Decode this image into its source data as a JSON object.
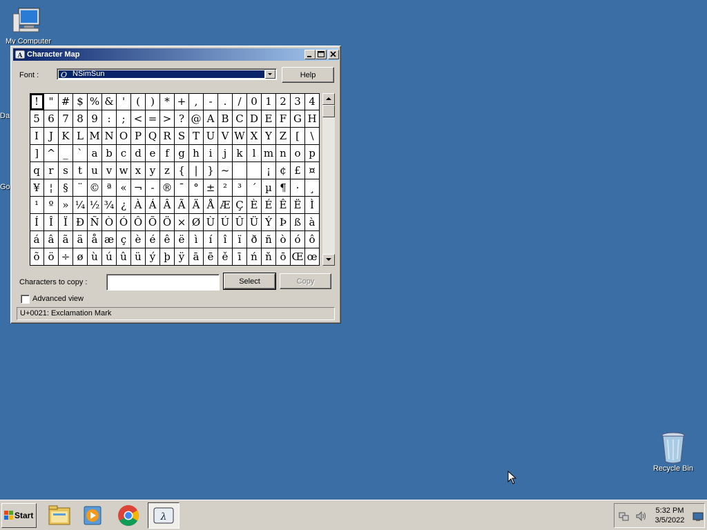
{
  "desktop": {
    "my_computer": "My Computer",
    "recycle_bin": "Recycle Bin",
    "partial_labels": [
      "Da",
      "Go"
    ],
    "background": "#3a6ea5"
  },
  "window": {
    "title": "Character Map",
    "font_label": "Font :",
    "font_value": "NSimSun",
    "help_label": "Help",
    "chars_to_copy_label": "Characters to copy :",
    "chars_to_copy_value": "",
    "select_label": "Select",
    "copy_label": "Copy",
    "advanced_label": "Advanced view",
    "advanced_checked": false,
    "status": "U+0021: Exclamation Mark",
    "characters": [
      [
        "!",
        "\"",
        "#",
        "$",
        "%",
        "&",
        "'",
        "(",
        ")",
        "*",
        "+",
        ",",
        "-",
        ".",
        "/",
        "0",
        "1",
        "2",
        "3",
        "4"
      ],
      [
        "5",
        "6",
        "7",
        "8",
        "9",
        ":",
        ";",
        "<",
        "=",
        ">",
        "?",
        "@",
        "A",
        "B",
        "C",
        "D",
        "E",
        "F",
        "G",
        "H"
      ],
      [
        "I",
        "J",
        "K",
        "L",
        "M",
        "N",
        "O",
        "P",
        "Q",
        "R",
        "S",
        "T",
        "U",
        "V",
        "W",
        "X",
        "Y",
        "Z",
        "[",
        "\\"
      ],
      [
        "]",
        "^",
        "_",
        "`",
        "a",
        "b",
        "c",
        "d",
        "e",
        "f",
        "g",
        "h",
        "i",
        "j",
        "k",
        "l",
        "m",
        "n",
        "o",
        "p"
      ],
      [
        "q",
        "r",
        "s",
        "t",
        "u",
        "v",
        "w",
        "x",
        "y",
        "z",
        "{",
        "|",
        "}",
        "~",
        " ",
        " ",
        "¡",
        "¢",
        "£",
        "¤"
      ],
      [
        "¥",
        "¦",
        "§",
        "¨",
        "©",
        "ª",
        "«",
        "¬",
        "-",
        "®",
        "¯",
        "°",
        "±",
        "²",
        "³",
        "´",
        "µ",
        "¶",
        "·",
        "¸"
      ],
      [
        "¹",
        "º",
        "»",
        "¼",
        "½",
        "¾",
        "¿",
        "À",
        "Á",
        "Â",
        "Ã",
        "Ä",
        "Å",
        "Æ",
        "Ç",
        "È",
        "É",
        "Ê",
        "Ë",
        "Ì"
      ],
      [
        "Í",
        "Î",
        "Ï",
        "Ð",
        "Ñ",
        "Ò",
        "Ó",
        "Ô",
        "Õ",
        "Ö",
        "×",
        "Ø",
        "Ù",
        "Ú",
        "Û",
        "Ü",
        "Ý",
        "Þ",
        "ß",
        "à"
      ],
      [
        "á",
        "â",
        "ã",
        "ä",
        "å",
        "æ",
        "ç",
        "è",
        "é",
        "ê",
        "ë",
        "ì",
        "í",
        "î",
        "ï",
        "ð",
        "ñ",
        "ò",
        "ó",
        "ô"
      ],
      [
        "õ",
        "ö",
        "÷",
        "ø",
        "ù",
        "ú",
        "û",
        "ü",
        "ý",
        "þ",
        "ÿ",
        "ā",
        "ē",
        "ě",
        "ī",
        "ń",
        "ň",
        "ō",
        "Œ",
        "œ"
      ]
    ],
    "selected": [
      0,
      0
    ]
  },
  "taskbar": {
    "start_label": "Start",
    "time": "5:32 PM",
    "date": "3/5/2022",
    "apps": [
      "file-explorer",
      "media-player",
      "chrome",
      "character-map"
    ]
  }
}
